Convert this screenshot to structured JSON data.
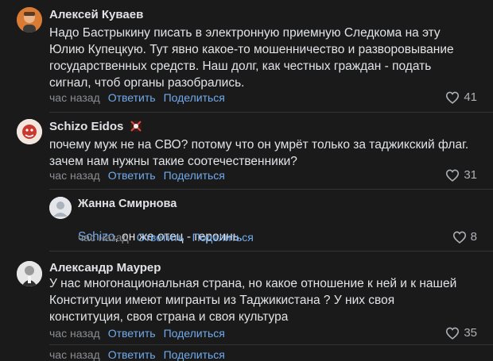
{
  "comments": [
    {
      "author": "Алексей Куваев",
      "text": "Надо Бастрыкину писать в электронную приемную Следкома на эту\nЮлию Купецкую. Тут явно какое-то мошенничество и разворовывание\nгосударственных средств. Наш долг, как честных граждан - подать\nсигнал, чтоб органы разобрались.",
      "time": "час назад",
      "reply_label": "Ответить",
      "share_label": "Поделиться",
      "likes": "41"
    },
    {
      "author": "Schizo Eidos",
      "text": "почему муж не на СВО? потому что он умрёт только за таджикский флаг.\nзачем нам нужны такие соотечественники?",
      "time": "час назад",
      "reply_label": "Ответить",
      "share_label": "Поделиться",
      "likes": "31"
    },
    {
      "author": "Жанна Смирнова",
      "mention": "Schizo",
      "text": ", он же отец - героинь.",
      "time": "час назад",
      "reply_label": "Ответить",
      "share_label": "Поделиться",
      "likes": "8"
    },
    {
      "author": "Александр Маурер",
      "text": "У нас многонациональная страна, но какое отношение к ней и к нашей\nКонституции имеют мигранты из Таджикистана ? У них своя\nконституция, своя страна и своя культура",
      "time": "час назад",
      "reply_label": "Ответить",
      "share_label": "Поделиться",
      "likes": "35"
    },
    {
      "time": "час назад",
      "reply_label": "Ответить",
      "share_label": "Поделиться"
    }
  ],
  "colors": {
    "background": "#1a1a1b",
    "link": "#71aaeb",
    "muted": "#8a8d91"
  },
  "icons": {
    "like": "heart-icon",
    "badge": "status-emoji-icon"
  }
}
